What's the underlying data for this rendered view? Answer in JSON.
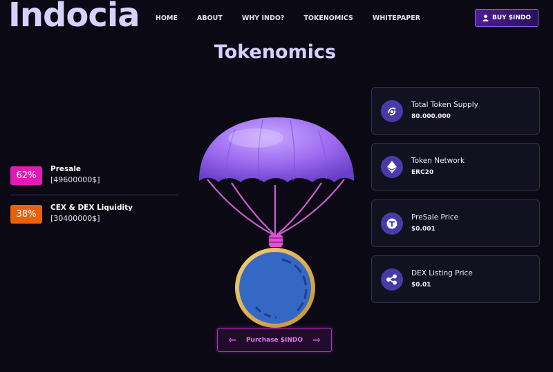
{
  "header": {
    "logo": "Indocia",
    "nav": [
      "HOME",
      "ABOUT",
      "WHY INDO?",
      "TOKENOMICS",
      "WHITEPAPER"
    ],
    "buy_label": "BUY $INDO"
  },
  "title": "Tokenomics",
  "allocations": [
    {
      "percent": "62%",
      "name": "Presale",
      "amount": "[49600000$]",
      "color": "#e11bb5"
    },
    {
      "percent": "38%",
      "name": "CEX & DEX Liquidity",
      "amount": "[30400000$]",
      "color": "#e8620c"
    }
  ],
  "cards": [
    {
      "label": "Total Token Supply",
      "value": "80.000.000",
      "icon": "supply-icon"
    },
    {
      "label": "Token Network",
      "value": "ERC20",
      "icon": "ethereum-icon"
    },
    {
      "label": "PreSale Price",
      "value": "$0.001",
      "icon": "tether-icon"
    },
    {
      "label": "DEX Listing Price",
      "value": "$0.01",
      "icon": "ripple-icon"
    }
  ],
  "purchase_label": "Purchase $INDO"
}
